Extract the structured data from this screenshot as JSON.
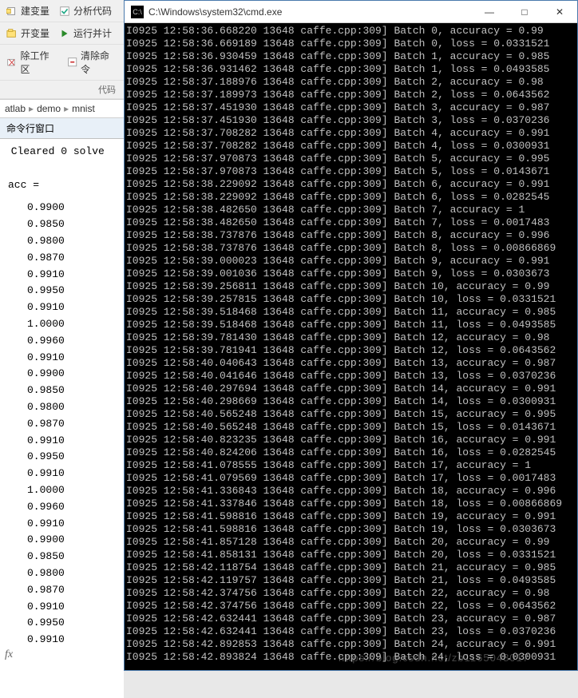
{
  "matlab": {
    "toolbar": {
      "row1a": "建变量",
      "row1b": "分析代码",
      "row2a": "开变量",
      "row2b": "运行并计",
      "row3a": "除工作区",
      "row3b": "清除命令",
      "codelabel": "代码"
    },
    "breadcrumb": {
      "seg1": "atlab",
      "seg2": "demo",
      "seg3": "mnist"
    },
    "panel_title": "命令行窗口",
    "output_line1": " Cleared 0 solve",
    "acc_label": "acc =",
    "acc_values": [
      "0.9900",
      "0.9850",
      "0.9800",
      "0.9870",
      "0.9910",
      "0.9950",
      "0.9910",
      "1.0000",
      "0.9960",
      "0.9910",
      "0.9900",
      "0.9850",
      "0.9800",
      "0.9870",
      "0.9910",
      "0.9950",
      "0.9910",
      "1.0000",
      "0.9960",
      "0.9910",
      "0.9900",
      "0.9850",
      "0.9800",
      "0.9870",
      "0.9910",
      "0.9950",
      "0.9910"
    ],
    "fx": "fx"
  },
  "cmd": {
    "title": "C:\\Windows\\system32\\cmd.exe",
    "icon_text": "C:\\",
    "min": "—",
    "max": "□",
    "close": "✕",
    "lines": [
      "I0925 12:58:36.668220 13648 caffe.cpp:309] Batch 0, accuracy = 0.99",
      "I0925 12:58:36.669189 13648 caffe.cpp:309] Batch 0, loss = 0.0331521",
      "I0925 12:58:36.930459 13648 caffe.cpp:309] Batch 1, accuracy = 0.985",
      "I0925 12:58:36.931462 13648 caffe.cpp:309] Batch 1, loss = 0.0493585",
      "I0925 12:58:37.188976 13648 caffe.cpp:309] Batch 2, accuracy = 0.98",
      "I0925 12:58:37.189973 13648 caffe.cpp:309] Batch 2, loss = 0.0643562",
      "I0925 12:58:37.451930 13648 caffe.cpp:309] Batch 3, accuracy = 0.987",
      "I0925 12:58:37.451930 13648 caffe.cpp:309] Batch 3, loss = 0.0370236",
      "I0925 12:58:37.708282 13648 caffe.cpp:309] Batch 4, accuracy = 0.991",
      "I0925 12:58:37.708282 13648 caffe.cpp:309] Batch 4, loss = 0.0300931",
      "I0925 12:58:37.970873 13648 caffe.cpp:309] Batch 5, accuracy = 0.995",
      "I0925 12:58:37.970873 13648 caffe.cpp:309] Batch 5, loss = 0.0143671",
      "I0925 12:58:38.229092 13648 caffe.cpp:309] Batch 6, accuracy = 0.991",
      "I0925 12:58:38.229092 13648 caffe.cpp:309] Batch 6, loss = 0.0282545",
      "I0925 12:58:38.482650 13648 caffe.cpp:309] Batch 7, accuracy = 1",
      "I0925 12:58:38.482650 13648 caffe.cpp:309] Batch 7, loss = 0.0017483",
      "I0925 12:58:38.737876 13648 caffe.cpp:309] Batch 8, accuracy = 0.996",
      "I0925 12:58:38.737876 13648 caffe.cpp:309] Batch 8, loss = 0.00866869",
      "I0925 12:58:39.000023 13648 caffe.cpp:309] Batch 9, accuracy = 0.991",
      "I0925 12:58:39.001036 13648 caffe.cpp:309] Batch 9, loss = 0.0303673",
      "I0925 12:58:39.256811 13648 caffe.cpp:309] Batch 10, accuracy = 0.99",
      "I0925 12:58:39.257815 13648 caffe.cpp:309] Batch 10, loss = 0.0331521",
      "I0925 12:58:39.518468 13648 caffe.cpp:309] Batch 11, accuracy = 0.985",
      "I0925 12:58:39.518468 13648 caffe.cpp:309] Batch 11, loss = 0.0493585",
      "I0925 12:58:39.781430 13648 caffe.cpp:309] Batch 12, accuracy = 0.98",
      "I0925 12:58:39.781941 13648 caffe.cpp:309] Batch 12, loss = 0.0643562",
      "I0925 12:58:40.040643 13648 caffe.cpp:309] Batch 13, accuracy = 0.987",
      "I0925 12:58:40.041646 13648 caffe.cpp:309] Batch 13, loss = 0.0370236",
      "I0925 12:58:40.297694 13648 caffe.cpp:309] Batch 14, accuracy = 0.991",
      "I0925 12:58:40.298669 13648 caffe.cpp:309] Batch 14, loss = 0.0300931",
      "I0925 12:58:40.565248 13648 caffe.cpp:309] Batch 15, accuracy = 0.995",
      "I0925 12:58:40.565248 13648 caffe.cpp:309] Batch 15, loss = 0.0143671",
      "I0925 12:58:40.823235 13648 caffe.cpp:309] Batch 16, accuracy = 0.991",
      "I0925 12:58:40.824206 13648 caffe.cpp:309] Batch 16, loss = 0.0282545",
      "I0925 12:58:41.078555 13648 caffe.cpp:309] Batch 17, accuracy = 1",
      "I0925 12:58:41.079569 13648 caffe.cpp:309] Batch 17, loss = 0.0017483",
      "I0925 12:58:41.336843 13648 caffe.cpp:309] Batch 18, accuracy = 0.996",
      "I0925 12:58:41.337846 13648 caffe.cpp:309] Batch 18, loss = 0.00866869",
      "I0925 12:58:41.598816 13648 caffe.cpp:309] Batch 19, accuracy = 0.991",
      "I0925 12:58:41.598816 13648 caffe.cpp:309] Batch 19, loss = 0.0303673",
      "I0925 12:58:41.857128 13648 caffe.cpp:309] Batch 20, accuracy = 0.99",
      "I0925 12:58:41.858131 13648 caffe.cpp:309] Batch 20, loss = 0.0331521",
      "I0925 12:58:42.118754 13648 caffe.cpp:309] Batch 21, accuracy = 0.985",
      "I0925 12:58:42.119757 13648 caffe.cpp:309] Batch 21, loss = 0.0493585",
      "I0925 12:58:42.374756 13648 caffe.cpp:309] Batch 22, accuracy = 0.98",
      "I0925 12:58:42.374756 13648 caffe.cpp:309] Batch 22, loss = 0.0643562",
      "I0925 12:58:42.632441 13648 caffe.cpp:309] Batch 23, accuracy = 0.987",
      "I0925 12:58:42.632441 13648 caffe.cpp:309] Batch 23, loss = 0.0370236",
      "I0925 12:58:42.892853 13648 caffe.cpp:309] Batch 24, accuracy = 0.991",
      "I0925 12:58:42.893824 13648 caffe.cpp:309] Batch 24, loss = 0.0300931"
    ]
  },
  "watermark": "https://blog.csdn.net/zb1165048017"
}
